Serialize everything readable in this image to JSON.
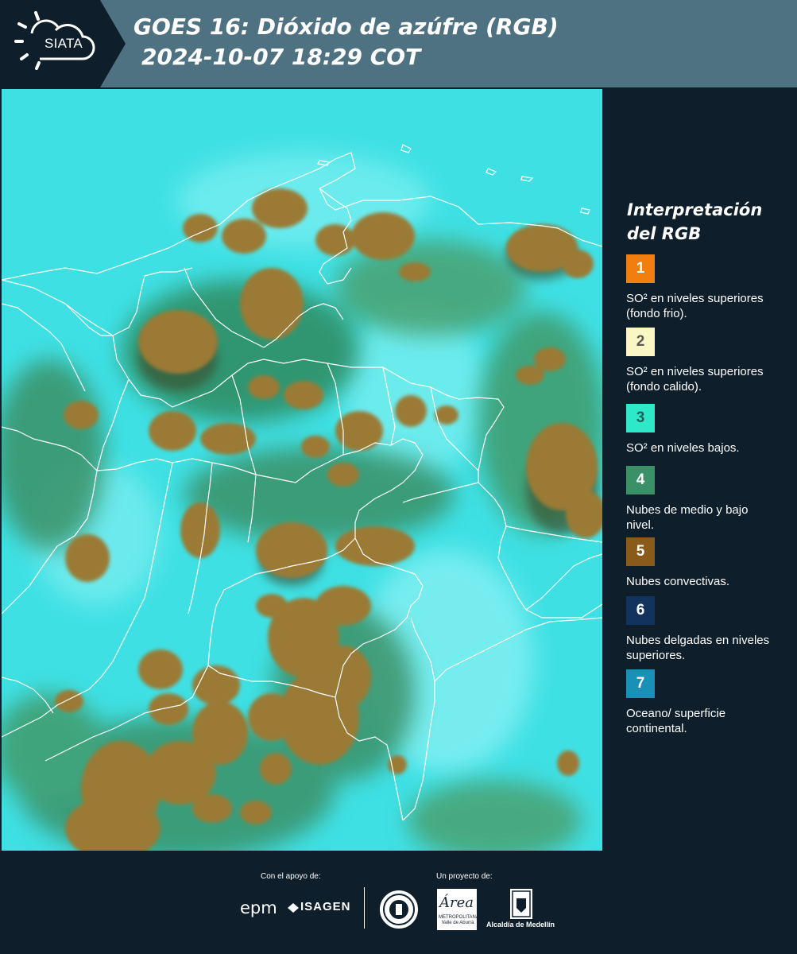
{
  "header": {
    "logo_text": "SIATA",
    "title": "GOES 16: Dióxido de azúfre (RGB)",
    "datetime": "2024-10-07 18:29 COT"
  },
  "legend": {
    "title": "Interpretación del RGB",
    "items": [
      {
        "number": "1",
        "label": "SO² en niveles superiores (fondo frio).",
        "color": "#f07f10",
        "text_color": "#ffffff"
      },
      {
        "number": "2",
        "label": "SO² en niveles superiores (fondo calido).",
        "color": "#fbf7c4",
        "text_color": "#5a5a5a"
      },
      {
        "number": "3",
        "label": "SO² en niveles bajos.",
        "color": "#2ee8c8",
        "text_color": "#1f5f5a"
      },
      {
        "number": "4",
        "label": "Nubes de medio y bajo nivel.",
        "color": "#3a9168",
        "text_color": "#ffffff"
      },
      {
        "number": "5",
        "label": "Nubes convectivas.",
        "color": "#8a5a1a",
        "text_color": "#ffffff"
      },
      {
        "number": "6",
        "label": "Nubes delgadas en niveles superiores.",
        "color": "#12335e",
        "text_color": "#ffffff"
      },
      {
        "number": "7",
        "label": "Oceano/ superficie continental.",
        "color": "#1a8fb8",
        "text_color": "#ffffff"
      }
    ]
  },
  "footer": {
    "support_label": "Con el apoyo de:",
    "project_label": "Un proyecto de:",
    "epm": "epm",
    "isagen": "ISAGEN",
    "area_logo": "Área",
    "area_sub": "METROPOLITANA Valle de Aburrá",
    "alcaldia": "Alcaldía de Medellín"
  },
  "colors": {
    "header_bg": "#4e7282",
    "panel_bg": "#0e1f2b",
    "clear_sky": "#3fe0e4",
    "convective_cloud": "#9a7a34",
    "mid_cloud": "#3a9168",
    "borders": "#ffffff"
  }
}
